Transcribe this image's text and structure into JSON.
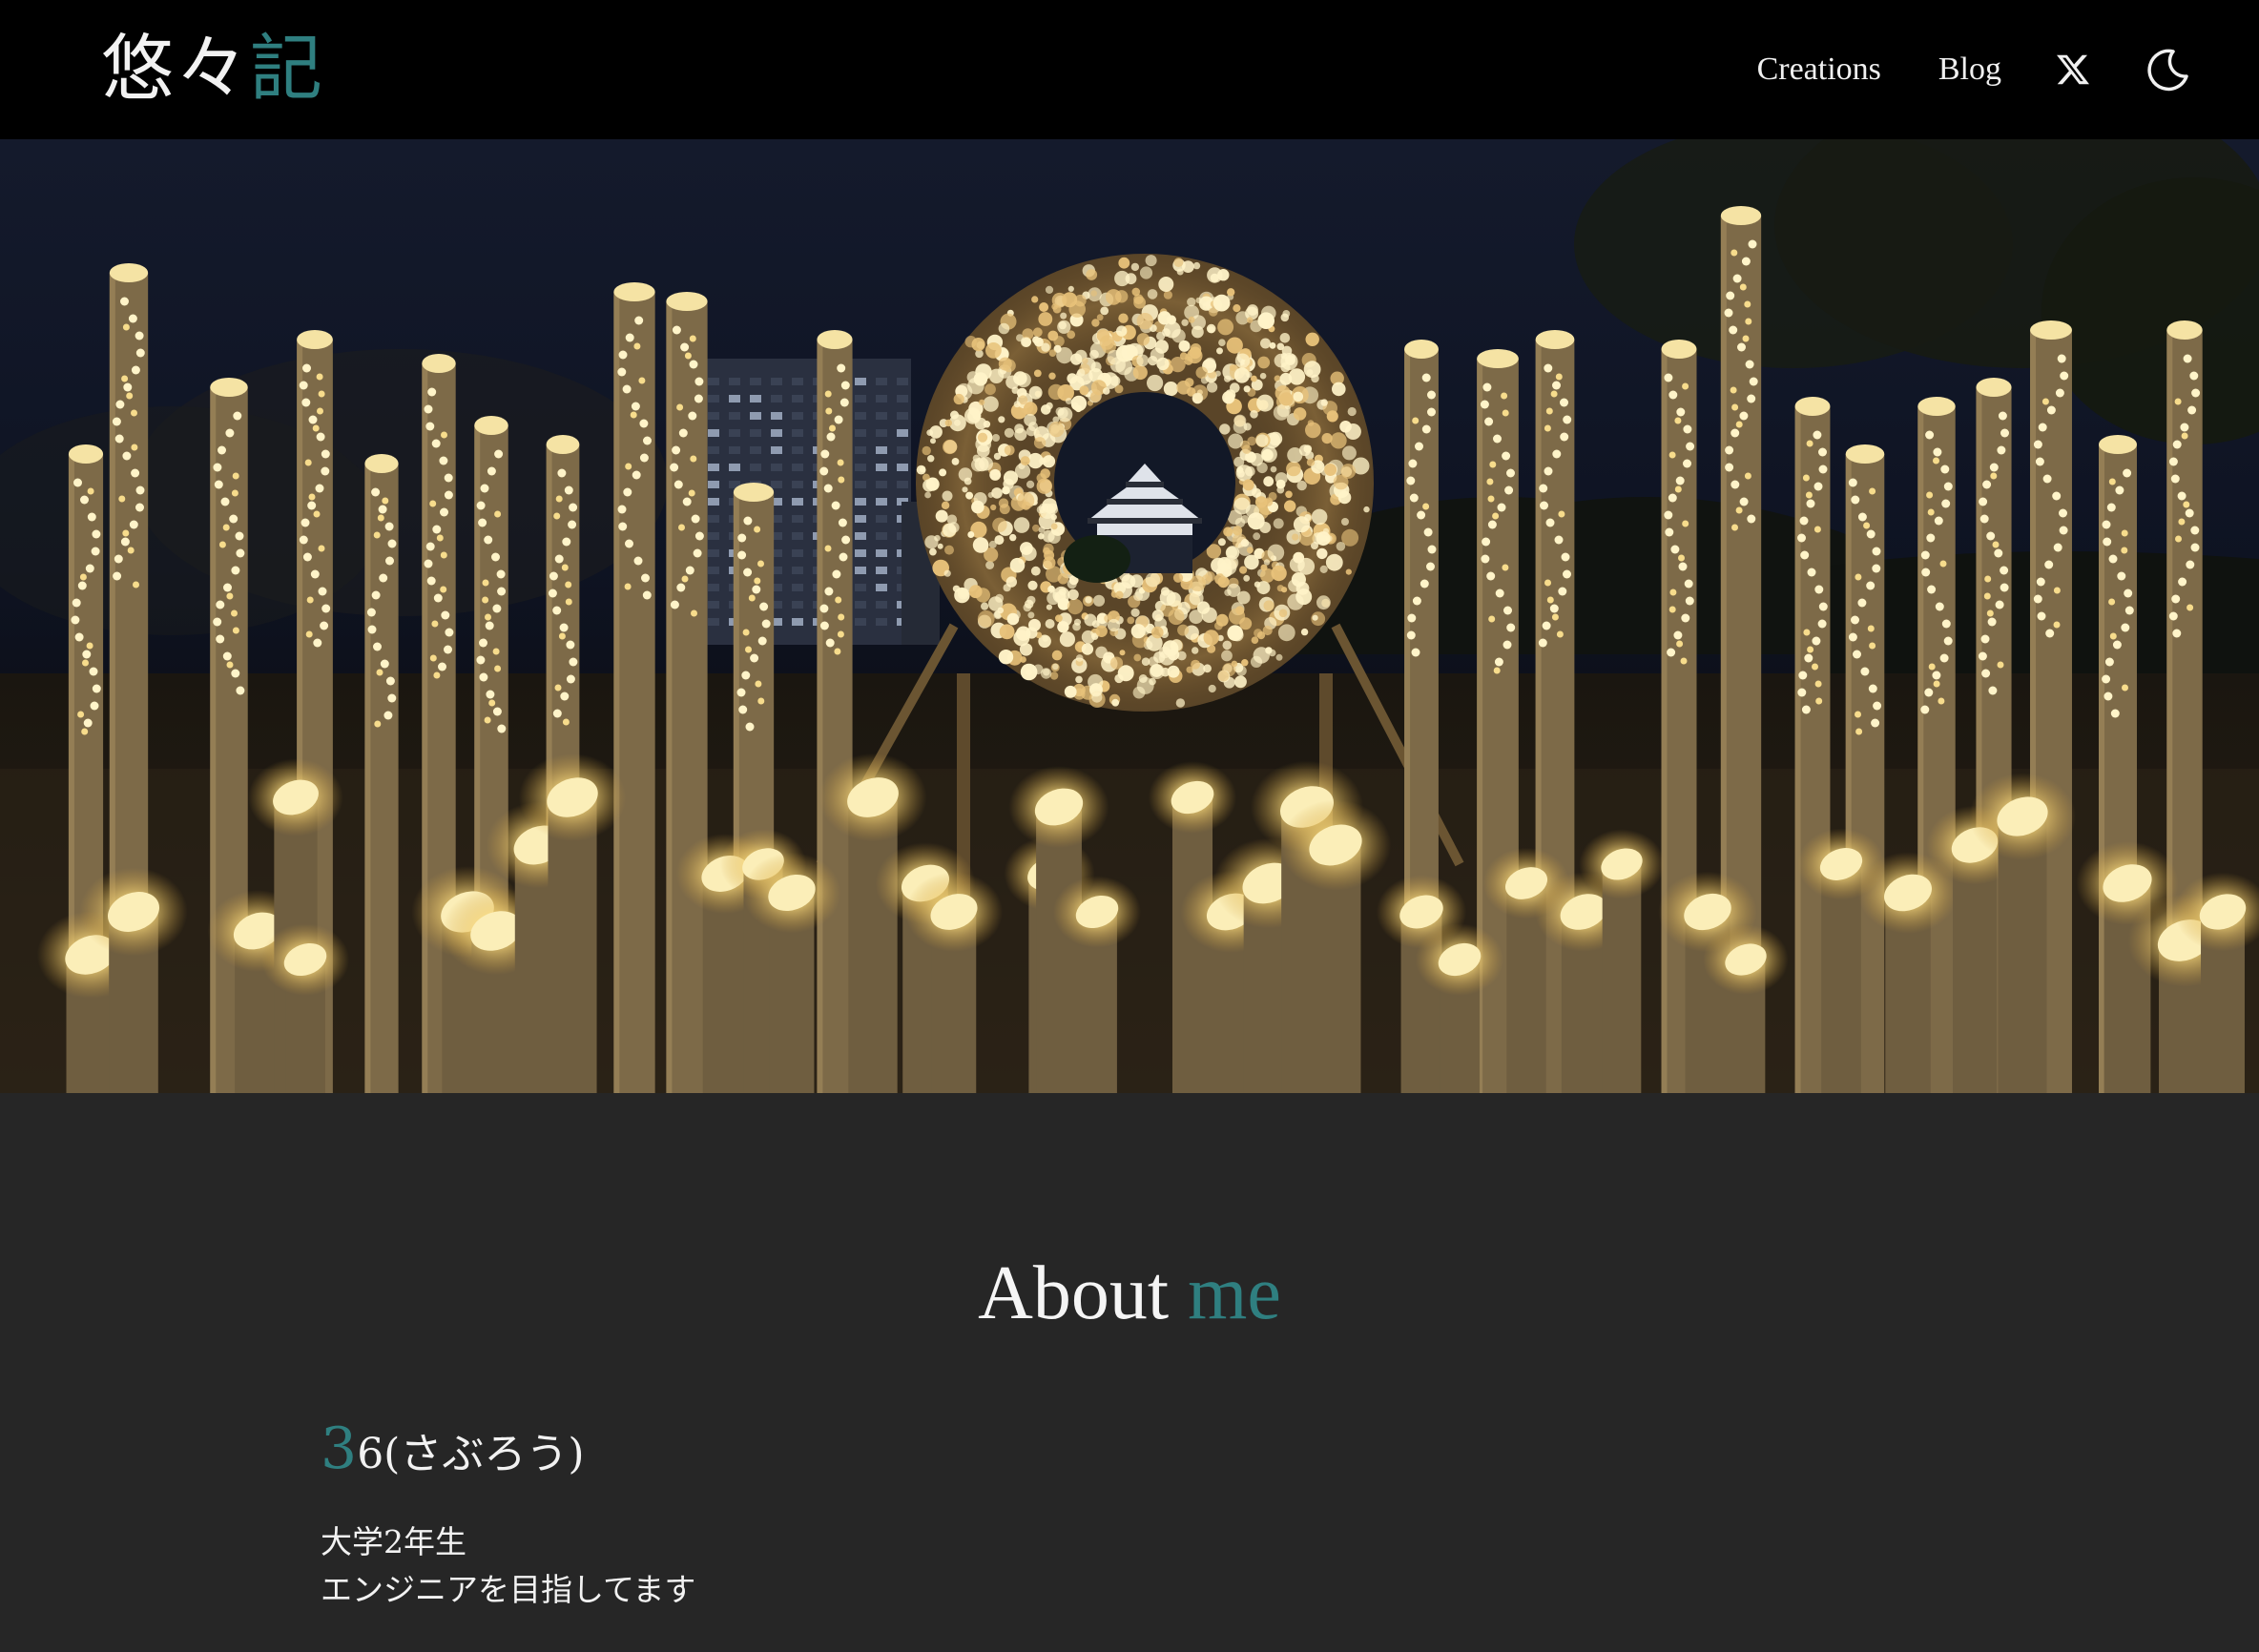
{
  "site": {
    "logo_part1": "悠々",
    "logo_part2": "記"
  },
  "nav": {
    "items": [
      {
        "label": "Creations"
      },
      {
        "label": "Blog"
      }
    ],
    "x_icon": "x-logo-icon",
    "theme_icon": "moon-icon"
  },
  "hero": {
    "image": "night-bamboo-lantern-illumination-with-castle"
  },
  "about": {
    "title_part1": "About",
    "title_part2": "me",
    "name_first": "3",
    "name_rest": "6(さぶろう)",
    "bio_lines": [
      "大学2年生",
      "エンジニアを目指してます"
    ]
  },
  "colors": {
    "accent": "#2f7f80",
    "header_bg": "#000000",
    "page_bg": "#262626",
    "text": "#f2f2f2"
  }
}
